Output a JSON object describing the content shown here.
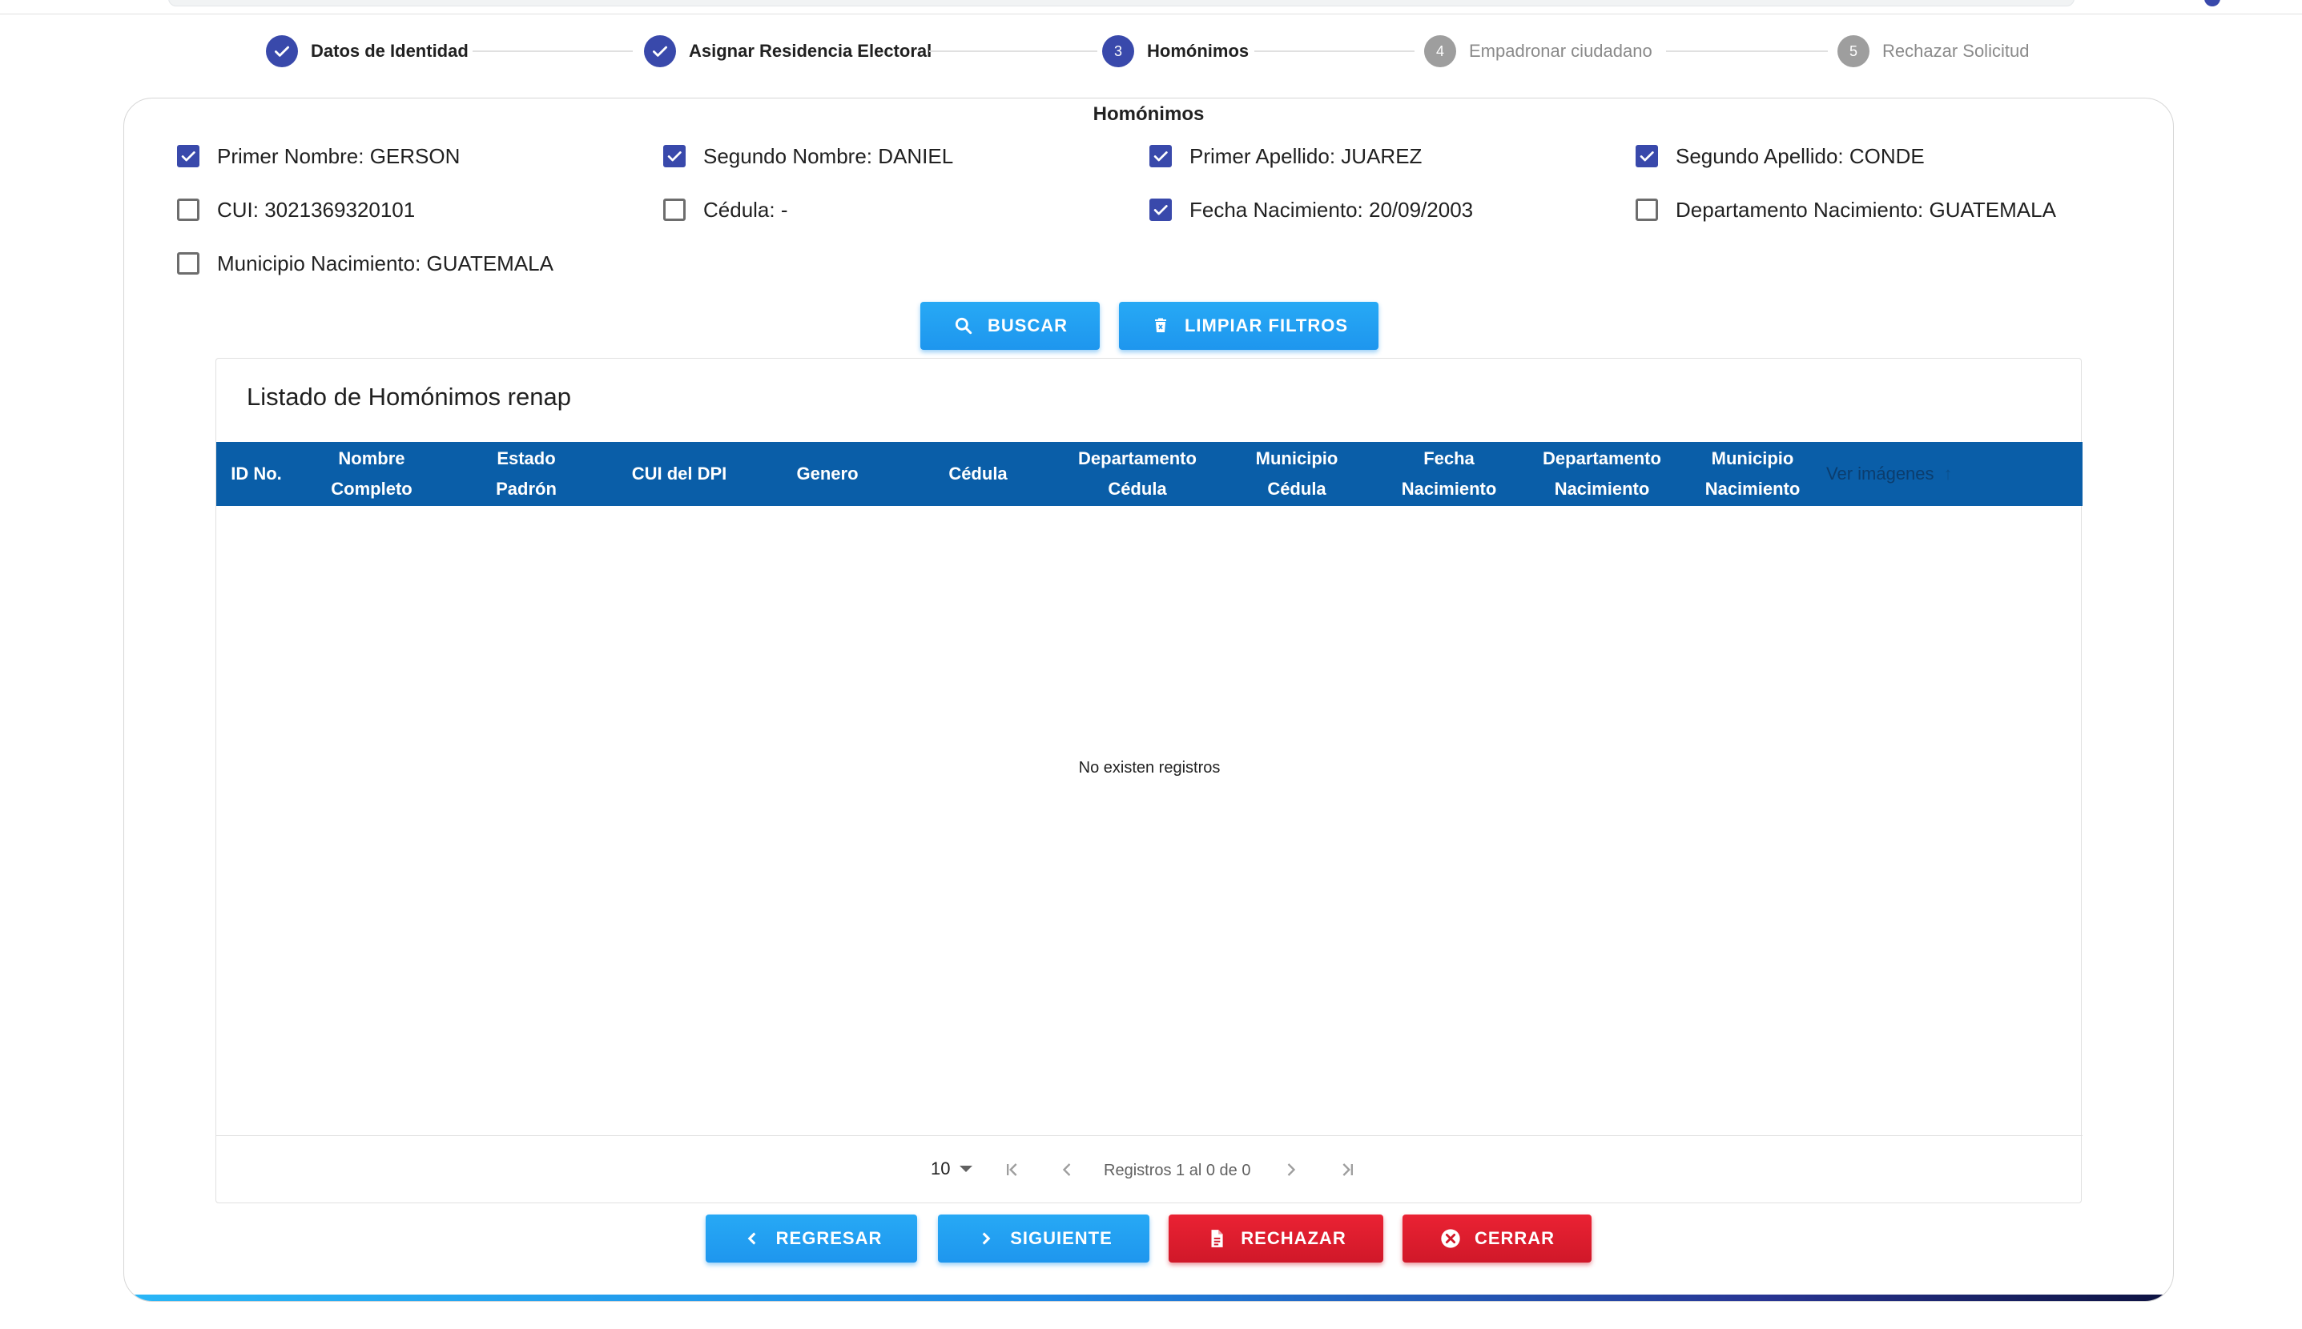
{
  "stepper": {
    "steps": [
      {
        "label": "Datos de Identidad",
        "state": "done",
        "number": ""
      },
      {
        "label": "Asignar Residencia Electoral",
        "state": "done",
        "number": ""
      },
      {
        "label": "Homónimos",
        "state": "active",
        "number": "3"
      },
      {
        "label": "Empadronar ciudadano",
        "state": "pending",
        "number": "4"
      },
      {
        "label": "Rechazar Solicitud",
        "state": "pending",
        "number": "5"
      }
    ]
  },
  "homonimos": {
    "title": "Homónimos",
    "filters": [
      {
        "label": "Primer Nombre: GERSON",
        "checked": true
      },
      {
        "label": "Segundo Nombre: DANIEL",
        "checked": true
      },
      {
        "label": "Primer Apellido: JUAREZ",
        "checked": true
      },
      {
        "label": "Segundo Apellido: CONDE",
        "checked": true
      },
      {
        "label": "CUI: 3021369320101",
        "checked": false
      },
      {
        "label": "Cédula: -",
        "checked": false
      },
      {
        "label": "Fecha Nacimiento: 20/09/2003",
        "checked": true
      },
      {
        "label": "Departamento Nacimiento: GUATEMALA",
        "checked": false
      },
      {
        "label": "Municipio Nacimiento: GUATEMALA",
        "checked": false
      }
    ],
    "buscar_label": "BUSCAR",
    "limpiar_label": "LIMPIAR FILTROS"
  },
  "table": {
    "title": "Listado de Homónimos renap",
    "columns": [
      [
        "ID No."
      ],
      [
        "Nombre",
        "Completo"
      ],
      [
        "Estado",
        "Padrón"
      ],
      [
        "CUI del DPI"
      ],
      [
        "Genero"
      ],
      [
        "Cédula"
      ],
      [
        "Departamento",
        "Cédula"
      ],
      [
        "Municipio",
        "Cédula"
      ],
      [
        "Fecha",
        "Nacimiento"
      ],
      [
        "Departamento",
        "Nacimiento"
      ],
      [
        "Municipio",
        "Nacimiento"
      ],
      [
        "Ver imágenes"
      ]
    ],
    "empty_message": "No existen registros",
    "page_size": "10",
    "range_label": "Registros 1 al 0 de 0"
  },
  "actions": {
    "regresar": "REGRESAR",
    "siguiente": "SIGUIENTE",
    "rechazar": "RECHAZAR",
    "cerrar": "CERRAR"
  },
  "colors": {
    "primary": "#3949ab",
    "header": "#0a5ea8",
    "blue_button": "#1e96ee",
    "red_button": "#d01829"
  }
}
